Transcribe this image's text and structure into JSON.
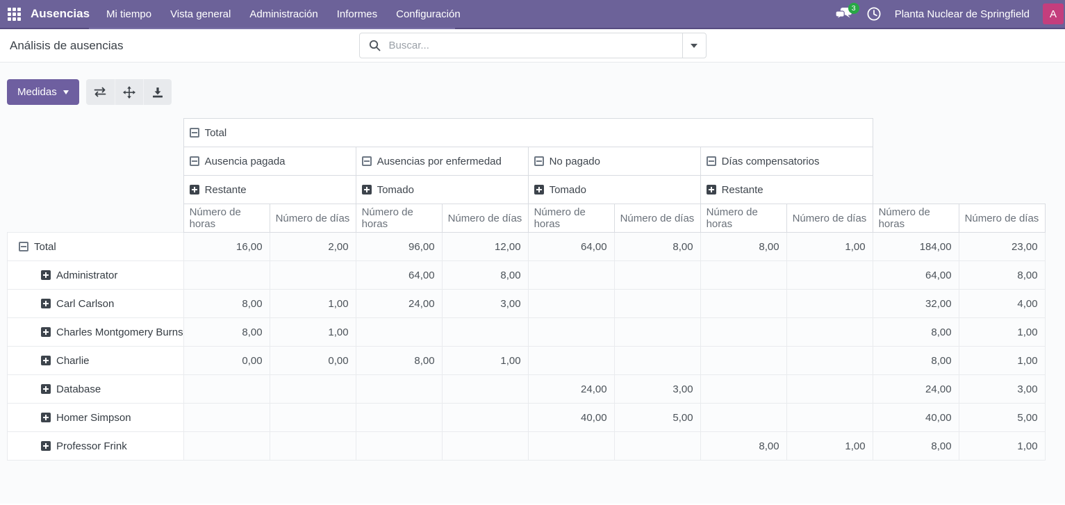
{
  "navbar": {
    "app_name": "Ausencias",
    "menu_items": [
      "Mi tiempo",
      "Vista general",
      "Administración",
      "Informes",
      "Configuración"
    ],
    "message_count": "3",
    "company_name": "Planta Nuclear de Springfield",
    "avatar_initial": "A"
  },
  "control_panel": {
    "title": "Análisis de ausencias",
    "search_placeholder": "Buscar..."
  },
  "toolbar": {
    "measures_label": "Medidas"
  },
  "colors": {
    "navbar_bg": "#6C6299",
    "accent_button": "#6E5FA0",
    "avatar_bg": "#C43E7D",
    "badge_bg": "#28A745"
  },
  "pivot": {
    "top_group_label": "Total",
    "column_groups": [
      {
        "label": "Ausencia pagada",
        "sub_label": "Restante"
      },
      {
        "label": "Ausencias por enfermedad",
        "sub_label": "Tomado"
      },
      {
        "label": "No pagado",
        "sub_label": "Tomado"
      },
      {
        "label": "Días compensatorios",
        "sub_label": "Restante"
      }
    ],
    "measure_headers": [
      "Número de horas",
      "Número de días"
    ],
    "measure_group_count": 5,
    "rows": [
      {
        "label": "Total",
        "level": 0,
        "expanded": true,
        "values": [
          "16,00",
          "2,00",
          "96,00",
          "12,00",
          "64,00",
          "8,00",
          "8,00",
          "1,00",
          "184,00",
          "23,00"
        ]
      },
      {
        "label": "Administrator",
        "level": 1,
        "expanded": false,
        "values": [
          "",
          "",
          "64,00",
          "8,00",
          "",
          "",
          "",
          "",
          "64,00",
          "8,00"
        ]
      },
      {
        "label": "Carl Carlson",
        "level": 1,
        "expanded": false,
        "values": [
          "8,00",
          "1,00",
          "24,00",
          "3,00",
          "",
          "",
          "",
          "",
          "32,00",
          "4,00"
        ]
      },
      {
        "label": "Charles Montgomery Burns",
        "level": 1,
        "expanded": false,
        "values": [
          "8,00",
          "1,00",
          "",
          "",
          "",
          "",
          "",
          "",
          "8,00",
          "1,00"
        ]
      },
      {
        "label": "Charlie",
        "level": 1,
        "expanded": false,
        "values": [
          "0,00",
          "0,00",
          "8,00",
          "1,00",
          "",
          "",
          "",
          "",
          "8,00",
          "1,00"
        ]
      },
      {
        "label": "Database",
        "level": 1,
        "expanded": false,
        "values": [
          "",
          "",
          "",
          "",
          "24,00",
          "3,00",
          "",
          "",
          "24,00",
          "3,00"
        ]
      },
      {
        "label": "Homer Simpson",
        "level": 1,
        "expanded": false,
        "values": [
          "",
          "",
          "",
          "",
          "40,00",
          "5,00",
          "",
          "",
          "40,00",
          "5,00"
        ]
      },
      {
        "label": "Professor Frink",
        "level": 1,
        "expanded": false,
        "values": [
          "",
          "",
          "",
          "",
          "",
          "",
          "8,00",
          "1,00",
          "8,00",
          "1,00"
        ]
      }
    ]
  }
}
